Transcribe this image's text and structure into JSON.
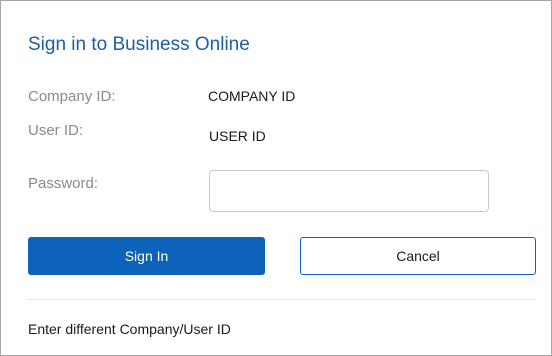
{
  "dialog": {
    "title": "Sign in to Business Online"
  },
  "fields": {
    "company": {
      "label": "Company ID:",
      "value": "COMPANY ID"
    },
    "user": {
      "label": "User ID:",
      "value": "USER ID"
    },
    "password": {
      "label": "Password:",
      "value": ""
    }
  },
  "buttons": {
    "sign_in": "Sign In",
    "cancel": "Cancel"
  },
  "footer": {
    "link_text": "Enter different Company/User ID"
  },
  "colors": {
    "title": "#1b5fa6",
    "primary": "#0d63b9",
    "label": "#8a8a8a",
    "border": "#a6a6a6"
  }
}
